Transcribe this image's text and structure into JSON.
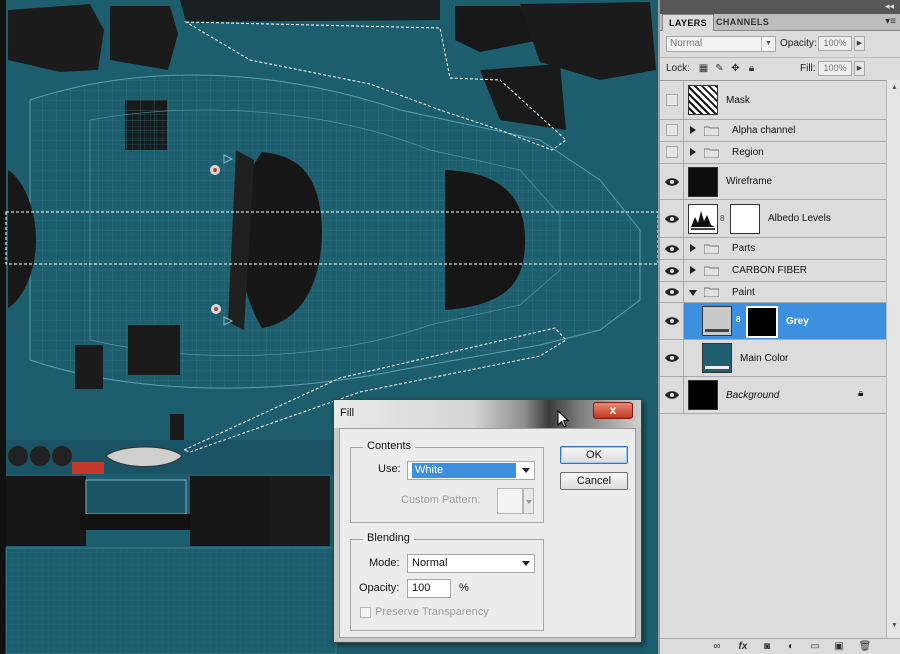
{
  "layers_panel": {
    "tabs": [
      {
        "label": "LAYERS",
        "active": true
      },
      {
        "label": "CHANNELS",
        "active": false
      }
    ],
    "blend_mode": "Normal",
    "opacity_label": "Opacity:",
    "opacity_value": "100%",
    "lock_label": "Lock:",
    "fill_label": "Fill:",
    "fill_value": "100%",
    "layers": [
      {
        "name": "Mask",
        "visible": false,
        "kind": "image"
      },
      {
        "name": "Alpha channel",
        "visible": false,
        "kind": "group",
        "expanded": false
      },
      {
        "name": "Region",
        "visible": false,
        "kind": "group",
        "expanded": false
      },
      {
        "name": "Wireframe",
        "visible": true,
        "kind": "image"
      },
      {
        "name": "Albedo Levels",
        "visible": true,
        "kind": "adjustment"
      },
      {
        "name": "Parts",
        "visible": true,
        "kind": "group",
        "expanded": false
      },
      {
        "name": "CARBON FIBER",
        "visible": true,
        "kind": "group",
        "expanded": false
      },
      {
        "name": "Paint",
        "visible": true,
        "kind": "group",
        "expanded": true
      },
      {
        "name": "Grey",
        "visible": true,
        "kind": "fill",
        "selected": true
      },
      {
        "name": "Main Color",
        "visible": true,
        "kind": "fill"
      },
      {
        "name": "Background",
        "visible": true,
        "kind": "background",
        "locked": true
      }
    ],
    "icons": [
      "link-icon",
      "fx-icon",
      "mask-icon",
      "adjustment-icon",
      "group-icon",
      "new-layer-icon",
      "trash-icon"
    ]
  },
  "fill_dialog": {
    "title": "Fill",
    "close_label": "x",
    "contents": {
      "title": "Contents",
      "use_label": "Use:",
      "use_value": "White",
      "custom_pattern_label": "Custom Pattern:"
    },
    "blending": {
      "title": "Blending",
      "mode_label": "Mode:",
      "mode_value": "Normal",
      "opacity_label": "Opacity:",
      "opacity_value": "100",
      "opacity_unit": "%",
      "preserve_label": "Preserve Transparency"
    },
    "ok_label": "OK",
    "cancel_label": "Cancel"
  },
  "colors": {
    "canvas_teal": "#1d5e6e",
    "selection_blue": "#3d8fdf",
    "main_color_swatch": "#1f5f6f"
  }
}
